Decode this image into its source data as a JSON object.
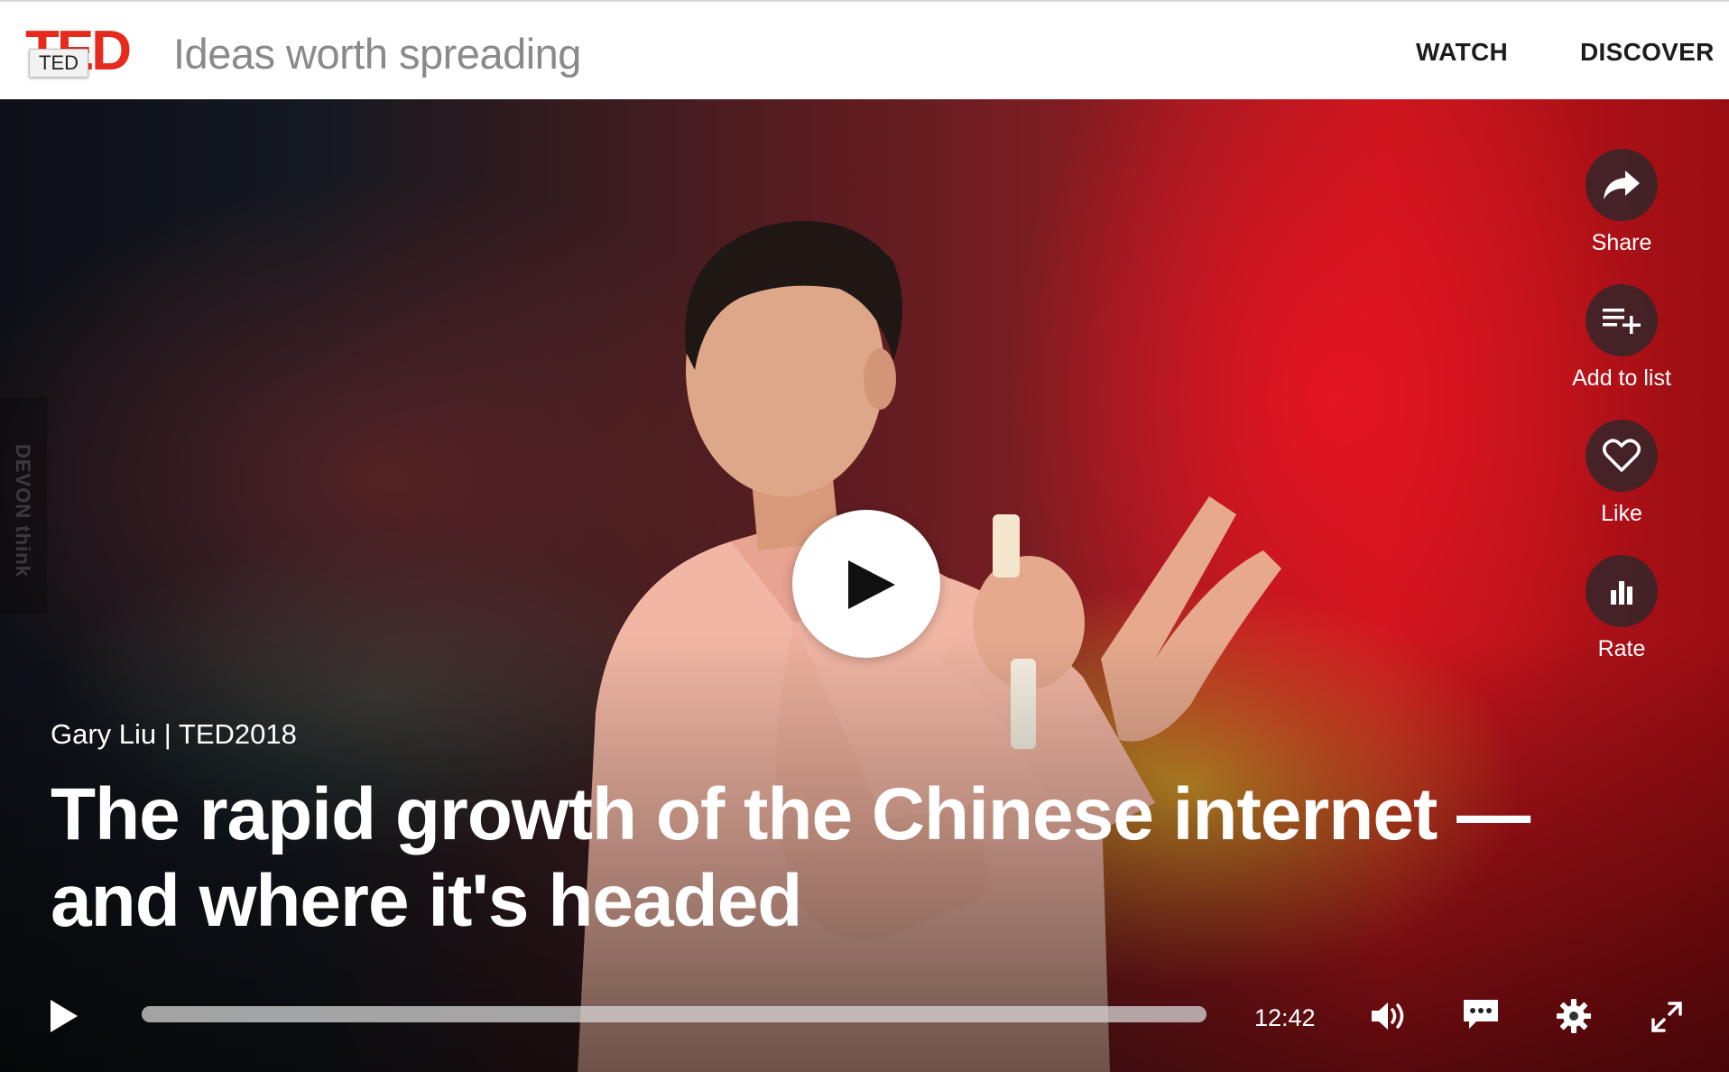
{
  "header": {
    "logo_text": "TED",
    "logo_tooltip": "TED",
    "tagline": "Ideas worth spreading",
    "nav": {
      "watch": "WATCH",
      "discover": "DISCOVER"
    }
  },
  "video": {
    "speaker_event": "Gary Liu | TED2018",
    "title": "The rapid growth of the Chinese internet — and where it's headed",
    "duration": "12:42",
    "progress": 0
  },
  "side_watermark": "DEVON think",
  "actions": {
    "share": "Share",
    "add_to_list": "Add to list",
    "like": "Like",
    "rate": "Rate"
  },
  "colors": {
    "brand_red": "#e62b1e",
    "header_bg": "#ffffff"
  }
}
